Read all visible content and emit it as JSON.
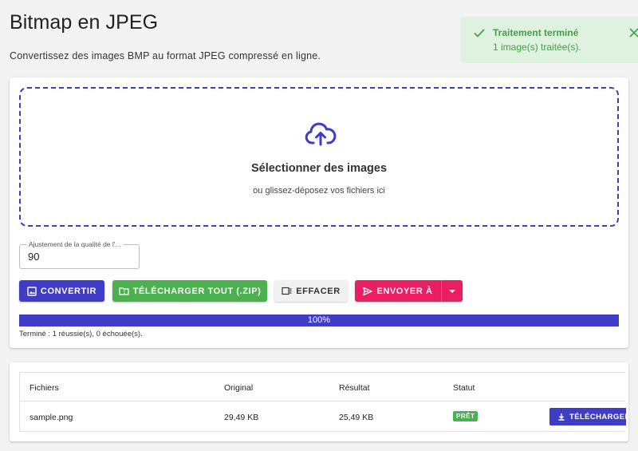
{
  "page": {
    "title": "Bitmap en JPEG",
    "subtitle": "Convertissez des images BMP au format JPEG compressé en ligne."
  },
  "toast": {
    "title": "Traitement terminé",
    "message": "1 image(s) traitée(s).",
    "icon": "check-icon",
    "close_icon": "close-icon",
    "color": "#43a047",
    "background": "#dff2df"
  },
  "dropzone": {
    "icon": "cloud-upload-icon",
    "title": "Sélectionner des images",
    "subtitle": "ou glissez-déposez vos fichiers ici",
    "border_color": "#3f3dc6"
  },
  "quality": {
    "label": "Ajustement de la qualité de l'...",
    "value": "90"
  },
  "actions": {
    "convert_label": "Convertir",
    "download_zip_label": "Télécharger tout (.zip)",
    "clear_label": "Effacer",
    "send_label": "Envoyer à",
    "convert_color": "#3f3dc6",
    "zip_color": "#4caf50",
    "send_color": "#e91e63"
  },
  "progress": {
    "percent_label": "100%",
    "value": 1.0,
    "status": "Terminé : 1 réussie(s), 0 échouée(s)."
  },
  "table": {
    "headers": {
      "files": "Fichiers",
      "original": "Original",
      "result": "Résultat",
      "status": "Statut"
    },
    "rows": [
      {
        "name": "sample.png",
        "original": "29,49 KB",
        "result": "25,49 KB",
        "status": "PRÊT",
        "download_label": "Télécharger"
      }
    ]
  }
}
